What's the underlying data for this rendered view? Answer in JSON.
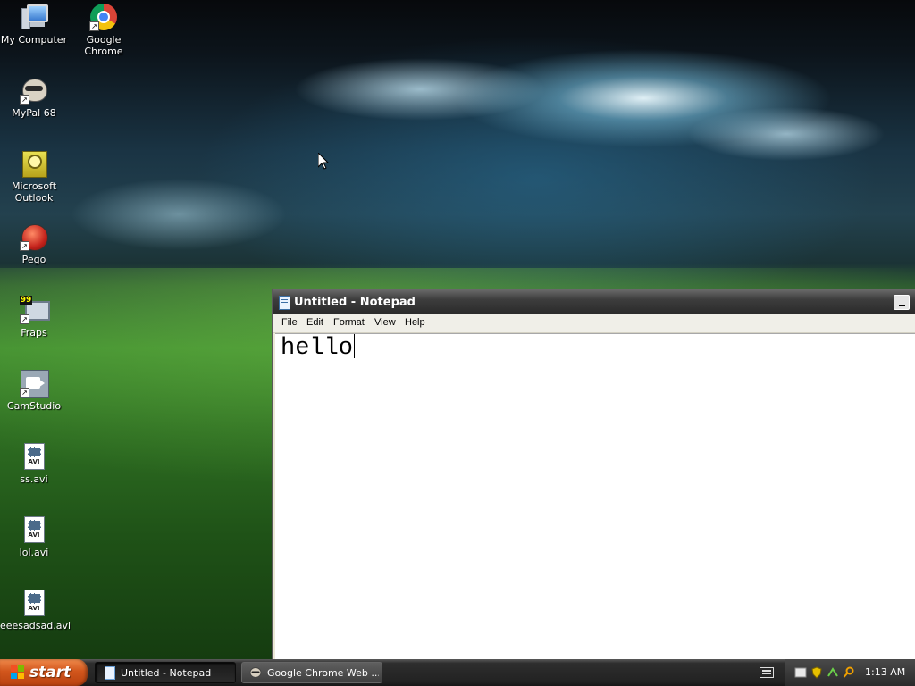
{
  "desktop": {
    "icons": [
      {
        "label": "My Computer",
        "icon": "computer-icon"
      },
      {
        "label": "Google Chrome",
        "icon": "chrome-icon"
      },
      {
        "label": "MyPal 68",
        "icon": "mypal-icon"
      },
      {
        "label": "Microsoft Outlook",
        "icon": "outlook-icon"
      },
      {
        "label": "Pego",
        "icon": "pego-icon"
      },
      {
        "label": "Fraps",
        "icon": "fraps-icon"
      },
      {
        "label": "CamStudio",
        "icon": "camstudio-icon"
      },
      {
        "label": "ss.avi",
        "icon": "avi-file-icon"
      },
      {
        "label": "lol.avi",
        "icon": "avi-file-icon"
      },
      {
        "label": "eeesadsad.avi",
        "icon": "avi-file-icon"
      }
    ],
    "avi_badge": "AVI",
    "fraps_badge": "99"
  },
  "notepad": {
    "title": "Untitled - Notepad",
    "menu": [
      "File",
      "Edit",
      "Format",
      "View",
      "Help"
    ],
    "content": "hello"
  },
  "taskbar": {
    "start_label": "start",
    "tasks": [
      {
        "label": "Untitled - Notepad",
        "active": true
      },
      {
        "label": "Google Chrome Web ...",
        "active": false
      }
    ],
    "clock": "1:13 AM"
  },
  "colors": {
    "start_button": "#d2561c",
    "taskbar": "#2e2e2e",
    "titlebar": "#3d3d3d"
  }
}
